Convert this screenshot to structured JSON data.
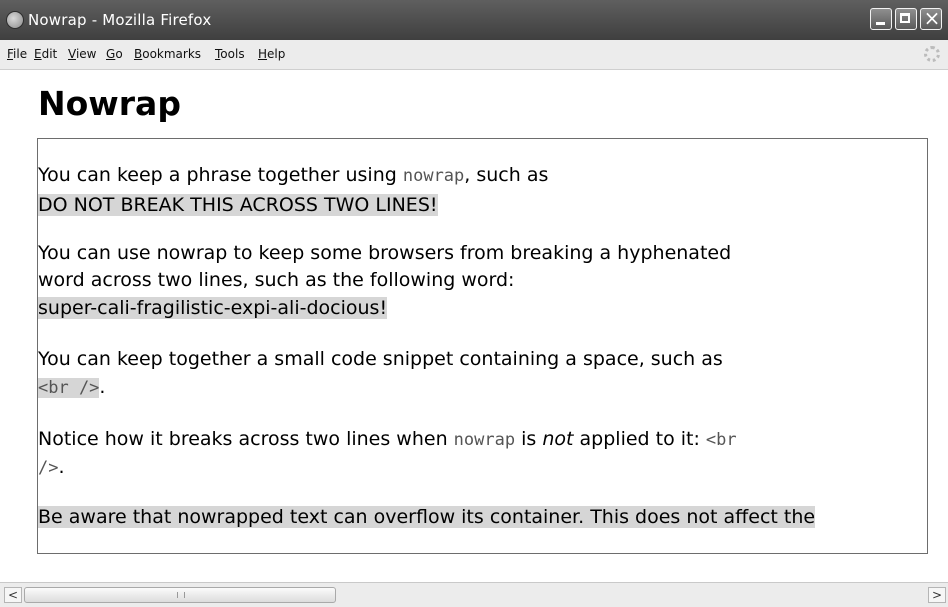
{
  "window": {
    "title": "Nowrap - Mozilla Firefox",
    "close_glyph": "×"
  },
  "menubar": {
    "items": [
      "File",
      "Edit",
      "View",
      "Go",
      "Bookmarks",
      "Tools",
      "Help"
    ]
  },
  "page": {
    "heading": "Nowrap",
    "p1": {
      "text_before": "You can keep a phrase together using ",
      "code": "nowrap",
      "text_after": ", such as",
      "highlight": "DO NOT BREAK THIS ACROSS TWO LINES!"
    },
    "p2": {
      "line1": "You can use nowrap to keep some browsers from breaking a hyphenated",
      "line2": "word across two lines, such as the following word:",
      "highlight": "super-cali-fragilistic-expi-ali-docious!"
    },
    "p3": {
      "line1": "You can keep together a small code snippet containing a space, such as",
      "code": "<br />",
      "text_after": "."
    },
    "p4": {
      "text_before": "Notice how it breaks across two lines when ",
      "code": "nowrap",
      "text_mid": " is ",
      "emphasis": "not",
      "text_after": " applied to it: ",
      "code_part1": "<br",
      "code_part2": "/>",
      "text_end": "."
    },
    "p5": {
      "highlight": "Be aware that nowrapped text can overflow its container. This does not affect the"
    }
  },
  "scrollbar": {
    "left_arrow": "<",
    "right_arrow": ">"
  }
}
